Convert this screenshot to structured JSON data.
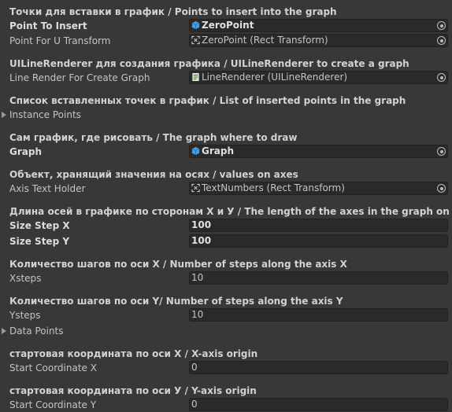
{
  "sections": {
    "s1": {
      "header": "Точки для вставки в график / Points to insert into the graph",
      "point_to_insert": {
        "label": "Point To Insert",
        "value": "ZeroPoint",
        "icon": "prefab-cube-icon"
      },
      "point_for_u": {
        "label": "Point For U Transform",
        "value": "ZeroPoint (Rect Transform)",
        "icon": "rect-transform-icon"
      }
    },
    "s2": {
      "header": "UILineRenderer для создания графика / UILineRenderer to create a graph",
      "line_render": {
        "label": "Line Render For Create Graph",
        "value": "LineRenderer (UILineRenderer)",
        "icon": "script-icon"
      }
    },
    "s3": {
      "header": "Список вставленных точек в график / List of inserted points in the graph",
      "instance_points": "Instance Points"
    },
    "s4": {
      "header": "Сам график, где рисовать / The graph where to draw",
      "graph": {
        "label": "Graph",
        "value": "Graph",
        "icon": "prefab-cube-icon"
      }
    },
    "s5": {
      "header": "Объект, хранящий значения на осях / values on axes",
      "axis_text": {
        "label": "Axis Text Holder",
        "value": "TextNumbers (Rect Transform)",
        "icon": "rect-transform-icon"
      }
    },
    "s6": {
      "header": "Длина осей в графике по сторонам X и У / The length of the axes in the graph on the sides X and",
      "size_x": {
        "label": "Size Step X",
        "value": "100"
      },
      "size_y": {
        "label": "Size Step Y",
        "value": "100"
      }
    },
    "s7": {
      "header": "Количество шагов по оси X / Number of steps along the axis X",
      "xsteps": {
        "label": "Xsteps",
        "value": "10"
      }
    },
    "s8": {
      "header": "Количество шагов по оси Y/ Number of steps along the axis Y",
      "ysteps": {
        "label": "Ysteps",
        "value": "10"
      },
      "data_points": "Data Points"
    },
    "s9": {
      "header": "стартовая координата по оси X / X-axis origin",
      "start_x": {
        "label": "Start Coordinate X",
        "value": "0"
      }
    },
    "s10": {
      "header": "стартовая координата по оси У / Y-axis origin",
      "start_y": {
        "label": "Start Coordinate Y",
        "value": "0"
      }
    }
  },
  "colors": {
    "background": "#383838",
    "field": "#2a2a2a",
    "prefab_icon": "#4a9fe0"
  }
}
